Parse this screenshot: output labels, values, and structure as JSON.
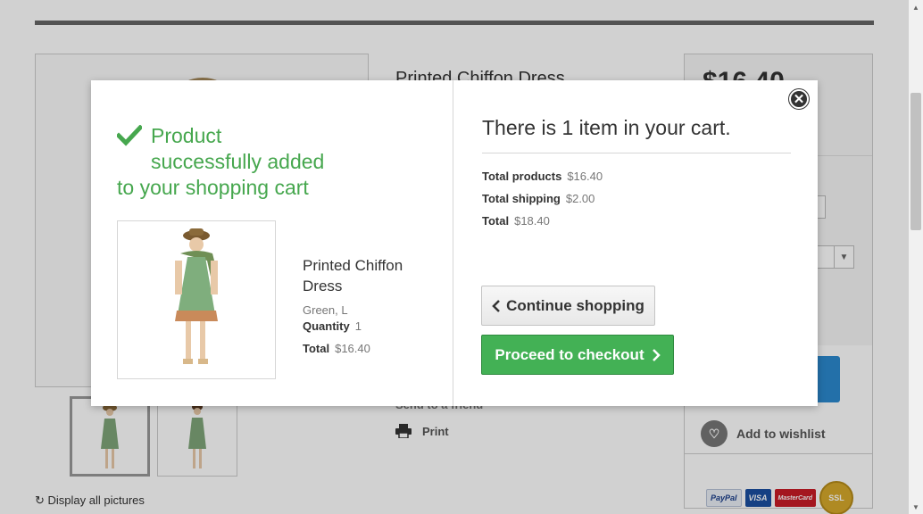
{
  "background": {
    "product_title": "Printed Chiffon Dress",
    "price": "$16.40",
    "send_to_friend": "Send to a friend",
    "print": "Print",
    "add_to_wishlist": "Add to wishlist",
    "display_all_pictures": "Display all pictures",
    "payments": [
      "PayPal",
      "VISA",
      "MasterCard",
      "SSL"
    ]
  },
  "modal": {
    "success_line1": "Product",
    "success_line2": "successfully added",
    "success_line3": "to your shopping cart",
    "product": {
      "name": "Printed Chiffon Dress",
      "attributes": "Green, L",
      "quantity_label": "Quantity",
      "quantity": "1",
      "total_label": "Total",
      "total": "$16.40"
    },
    "cart": {
      "count_text": "There is 1 item in your cart.",
      "total_products_label": "Total products",
      "total_products": "$16.40",
      "total_shipping_label": "Total shipping",
      "total_shipping": "$2.00",
      "total_label": "Total",
      "total": "$18.40"
    },
    "continue_shopping": "Continue shopping",
    "proceed_to_checkout": "Proceed to checkout",
    "close_icon": "close-icon"
  },
  "colors": {
    "success_green": "#46a74e",
    "checkout_green": "#43b155",
    "cart_button_blue": "#2b89cf"
  }
}
